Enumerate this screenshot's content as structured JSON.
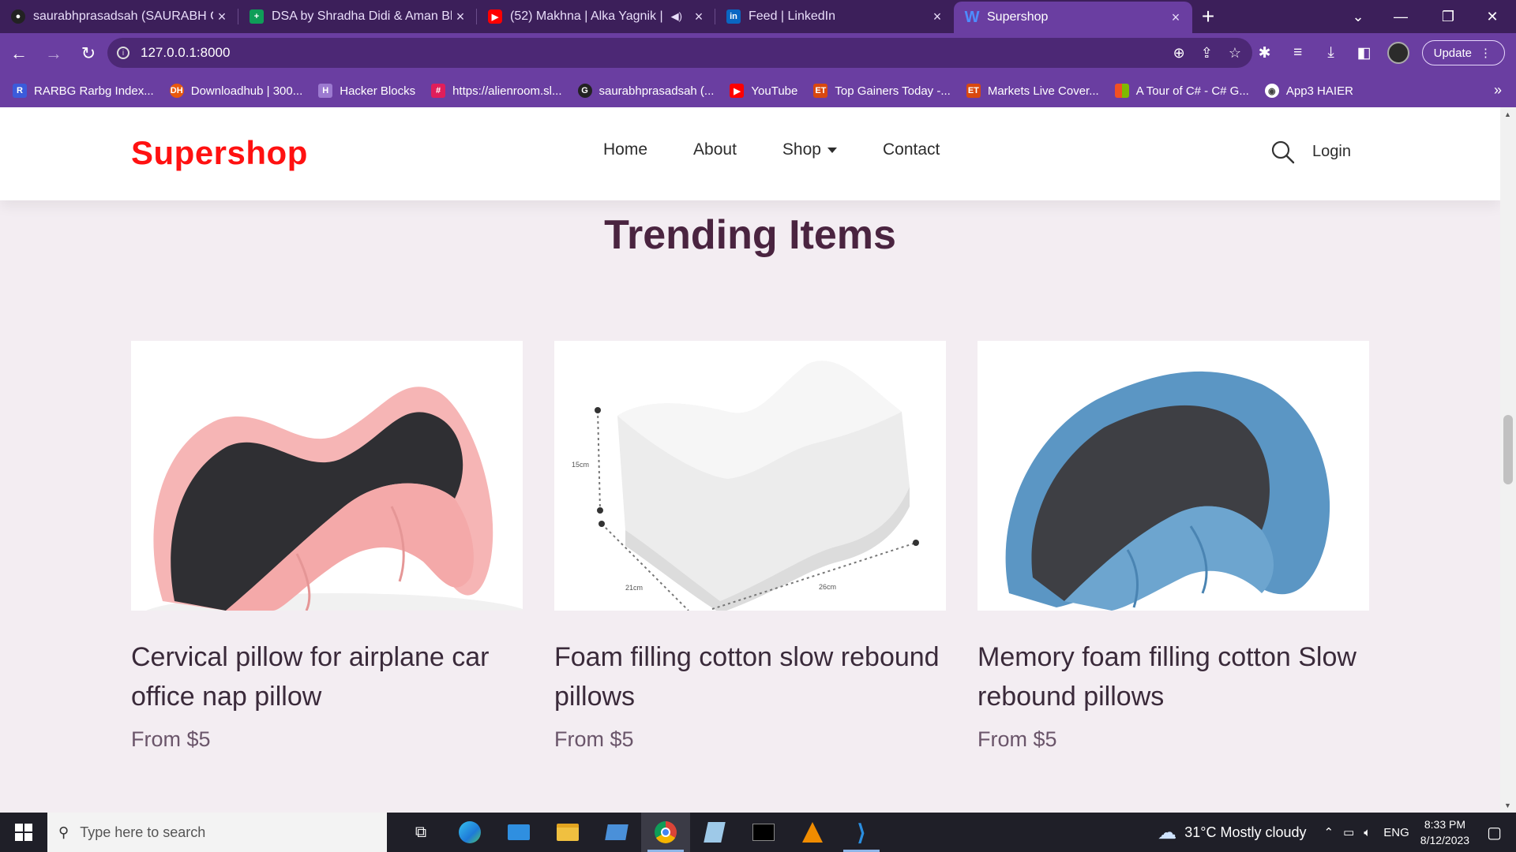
{
  "browser": {
    "tabs": [
      {
        "label": "saurabhprasadsah (SAURABH GU",
        "icon": "github-icon",
        "color": "#222222"
      },
      {
        "label": "DSA by Shradha Didi & Aman Bh",
        "icon": "sheets-icon",
        "color": "#0f9d58"
      },
      {
        "label": "(52) Makhna | Alka Yagnik | U",
        "icon": "youtube-icon",
        "color": "#ff0000"
      },
      {
        "label": "Feed | LinkedIn",
        "icon": "linkedin-icon",
        "color": "#0a66c2"
      },
      {
        "label": "Supershop",
        "icon": "wordpress-icon",
        "color": "#2b6cf6"
      }
    ],
    "url": "127.0.0.1:8000",
    "update_label": "Update",
    "bookmarks": [
      {
        "label": "RARBG Rarbg Index...",
        "badge": "R",
        "color": "#3b5bdb"
      },
      {
        "label": "Downloadhub | 300...",
        "badge": "DH",
        "color": "#e8590c"
      },
      {
        "label": "Hacker Blocks",
        "badge": "H",
        "color": "#6a3ea1"
      },
      {
        "label": "https://alienroom.sl...",
        "badge": "#",
        "color": "#e01e5a"
      },
      {
        "label": "saurabhprasadsah (...",
        "badge": "G",
        "color": "#222222"
      },
      {
        "label": "YouTube",
        "badge": "▶",
        "color": "#ff0000"
      },
      {
        "label": "Top Gainers Today -...",
        "badge": "ET",
        "color": "#d9480f"
      },
      {
        "label": "Markets Live Cover...",
        "badge": "ET",
        "color": "#d9480f"
      },
      {
        "label": "A Tour of C# - C# G...",
        "badge": "⊞",
        "color": "#f25022"
      },
      {
        "label": "App3 HAIER",
        "badge": "◉",
        "color": "#444444"
      }
    ]
  },
  "site": {
    "brand": "Supershop",
    "nav": [
      "Home",
      "About",
      "Shop",
      "Contact"
    ],
    "login": "Login",
    "section_title": "Trending Items",
    "products": [
      {
        "title": "Cervical pillow for airplane car office nap pillow",
        "price": "From $5"
      },
      {
        "title": "Foam filling cotton slow rebound pillows",
        "price": "From $5",
        "dims": [
          "15cm",
          "21cm",
          "26cm"
        ]
      },
      {
        "title": "Memory foam filling cotton Slow rebound pillows",
        "price": "From $5"
      }
    ],
    "colors": {
      "brand": "#ff1111",
      "title": "#4a2440",
      "bg": "#f3edf2"
    }
  },
  "taskbar": {
    "search_placeholder": "Type here to search",
    "weather": "31°C  Mostly cloudy",
    "lang": "ENG",
    "time": "8:33 PM",
    "date": "8/12/2023"
  }
}
